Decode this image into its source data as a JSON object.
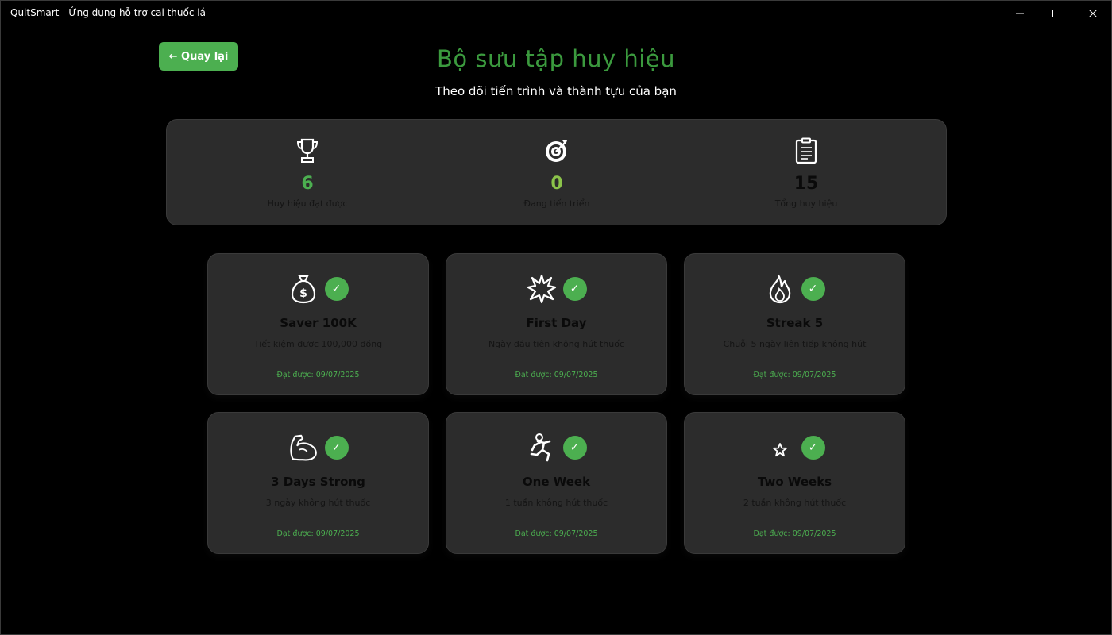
{
  "window": {
    "title": "QuitSmart - Ứng dụng hỗ trợ cai thuốc lá"
  },
  "back_button": "← Quay lại",
  "header": {
    "title": "Bộ sưu tập huy hiệu",
    "subtitle": "Theo dõi tiến trình và thành tựu của bạn"
  },
  "stats": [
    {
      "icon": "trophy-icon",
      "value": "6",
      "label": "Huy hiệu đạt được",
      "color": "#4caf50"
    },
    {
      "icon": "target-icon",
      "value": "0",
      "label": "Đang tiến triển",
      "color": "#8bc34a"
    },
    {
      "icon": "clipboard-icon",
      "value": "15",
      "label": "Tổng huy hiệu",
      "color": "#0a0a0a"
    }
  ],
  "badges": [
    {
      "icon": "money-bag-icon",
      "name": "Saver 100K",
      "desc": "Tiết kiệm được 100,000 đồng",
      "date": "Đạt được: 09/07/2025"
    },
    {
      "icon": "explosion-icon",
      "name": "First Day",
      "desc": "Ngày đầu tiên không hút thuốc",
      "date": "Đạt được: 09/07/2025"
    },
    {
      "icon": "fire-icon",
      "name": "Streak 5",
      "desc": "Chuỗi 5 ngày liên tiếp không hút",
      "date": "Đạt được: 09/07/2025"
    },
    {
      "icon": "flexed-bicep-icon",
      "name": "3 Days Strong",
      "desc": "3 ngày không hút thuốc",
      "date": "Đạt được: 09/07/2025"
    },
    {
      "icon": "runner-icon",
      "name": "One Week",
      "desc": "1 tuần không hút thuốc",
      "date": "Đạt được: 09/07/2025"
    },
    {
      "icon": "star-icon",
      "name": "Two Weeks",
      "desc": "2 tuần không hút thuốc",
      "date": "Đạt được: 09/07/2025"
    }
  ],
  "check_glyph": "✓",
  "colors": {
    "accent": "#4caf50",
    "title": "#3b9a3e",
    "card_bg": "#2c2c2c"
  }
}
